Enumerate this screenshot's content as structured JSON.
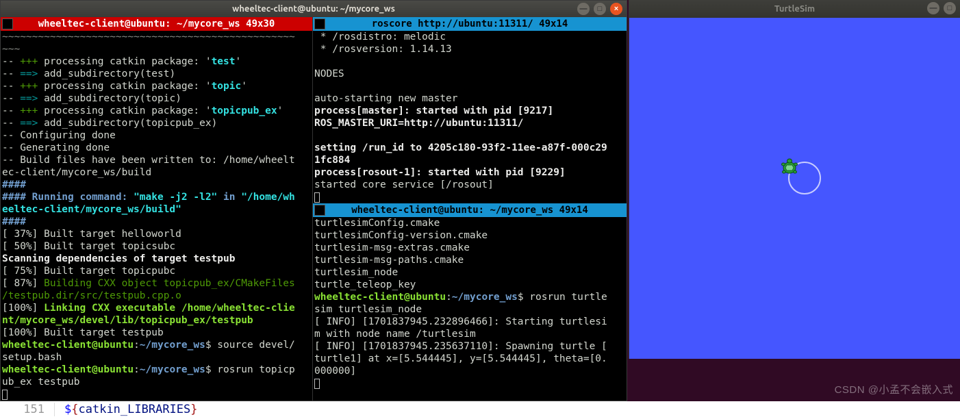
{
  "main_window": {
    "title": "wheeltec-client@ubuntu: ~/mycore_ws"
  },
  "left_pane": {
    "title": "wheeltec-client@ubuntu: ~/mycore_ws 49x30",
    "lines": {
      "l0": "~~~~~~~~~~~~~~~~~~~~~~~~~~~~~~~~~~~~~~~~~~~~~~~~~",
      "l1": "~~~",
      "l2a": "-- ",
      "l2b": "+++",
      "l2c": " processing catkin package: '",
      "l2d": "test",
      "l2e": "'",
      "l3a": "-- ",
      "l3b": "==>",
      "l3c": " add_subdirectory(test)",
      "l4a": "-- ",
      "l4b": "+++",
      "l4c": " processing catkin package: '",
      "l4d": "topic",
      "l4e": "'",
      "l5a": "-- ",
      "l5b": "==>",
      "l5c": " add_subdirectory(topic)",
      "l6a": "-- ",
      "l6b": "+++",
      "l6c": " processing catkin package: '",
      "l6d": "topicpub_ex",
      "l6e": "'",
      "l7a": "-- ",
      "l7b": "==>",
      "l7c": " add_subdirectory(topicpub_ex)",
      "l8": "-- Configuring done",
      "l9": "-- Generating done",
      "l10": "-- Build files have been written to: /home/wheelt",
      "l11": "ec-client/mycore_ws/build",
      "l12": "####",
      "l13a": "#### Running command: ",
      "l13b": "\"make -j2 -l2\"",
      "l13c": " in ",
      "l13d": "\"/home/wh",
      "l14": "eeltec-client/mycore_ws/build\"",
      "l15": "####",
      "l16": "[ 37%] Built target helloworld",
      "l17": "[ 50%] Built target topicsubc",
      "l18": "Scanning dependencies of target testpub",
      "l19": "[ 75%] Built target topicpubc",
      "l20a": "[ 87%] ",
      "l20b": "Building CXX object topicpub_ex/CMakeFiles",
      "l21": "/testpub.dir/src/testpub.cpp.o",
      "l22a": "[100%] ",
      "l22b": "Linking CXX executable /home/wheeltec-clie",
      "l23": "nt/mycore_ws/devel/lib/topicpub_ex/testpub",
      "l24": "[100%] Built target testpub",
      "p1_user": "wheeltec-client@ubuntu",
      "p1_colon": ":",
      "p1_path": "~/mycore_ws",
      "p1_dollar": "$ ",
      "p1_cmd": "source devel/",
      "p1_cmd2": "setup.bash",
      "p2_user": "wheeltec-client@ubuntu",
      "p2_colon": ":",
      "p2_path": "~/mycore_ws",
      "p2_dollar": "$ ",
      "p2_cmd": "rosrun topicp",
      "p2_cmd2": "ub_ex testpub"
    }
  },
  "top_right_pane": {
    "title": "roscore http://ubuntu:11311/ 49x14",
    "lines": {
      "l1": " * /rosdistro: melodic",
      "l2": " * /rosversion: 1.14.13",
      "l3": "",
      "l4": "NODES",
      "l5": "",
      "l6": "auto-starting new master",
      "l7": "process[master]: started with pid [9217]",
      "l8": "ROS_MASTER_URI=http://ubuntu:11311/",
      "l9": "",
      "l10": "setting /run_id to 4205c180-93f2-11ee-a87f-000c29",
      "l11": "1fc884",
      "l12": "process[rosout-1]: started with pid [9229]",
      "l13": "started core service [/rosout]"
    }
  },
  "bottom_right_pane": {
    "title": "wheeltec-client@ubuntu: ~/mycore_ws 49x14",
    "lines": {
      "l1": "turtlesimConfig.cmake",
      "l2": "turtlesimConfig-version.cmake",
      "l3": "turtlesim-msg-extras.cmake",
      "l4": "turtlesim-msg-paths.cmake",
      "l5": "turtlesim_node",
      "l6": "turtle_teleop_key",
      "p1_user": "wheeltec-client@ubuntu",
      "p1_colon": ":",
      "p1_path": "~/mycore_ws",
      "p1_dollar": "$ ",
      "p1_cmd": "rosrun turtle",
      "p1_cmd2": "sim turtlesim_node",
      "l9": "[ INFO] [1701837945.232896466]: Starting turtlesi",
      "l10": "m with node name /turtlesim",
      "l11": "[ INFO] [1701837945.235637110]: Spawning turtle [",
      "l12": "turtle1] at x=[5.544445], y=[5.544445], theta=[0.",
      "l13": "000000]"
    }
  },
  "turtlesim": {
    "title": "TurtleSim"
  },
  "editor": {
    "line_number": "151",
    "dollar": "$",
    "brace_open": "{",
    "var": "catkin_LIBRARIES",
    "brace_close": "}"
  },
  "watermark": "CSDN @小孟不会嵌入式"
}
